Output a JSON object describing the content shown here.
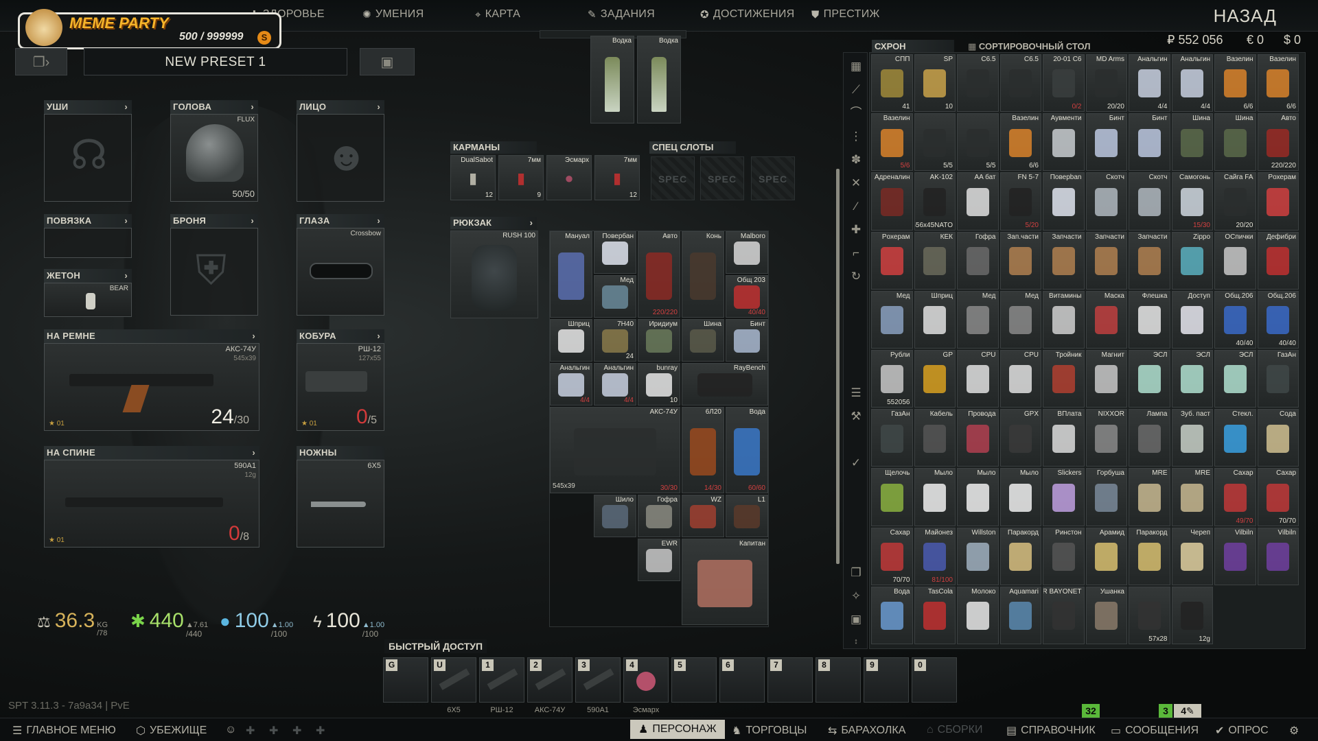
{
  "app": {
    "back_label": "НАЗАД",
    "version": "SPT 3.11.3 - 7a9a34 | PvE"
  },
  "logo": {
    "name": "MEME PARTY",
    "coins": "500 / 999999",
    "coin_icon": "S"
  },
  "nav": [
    {
      "label": "ЗДОРОВЬЕ",
      "icon": "health-icon"
    },
    {
      "label": "УМЕНИЯ",
      "icon": "skills-icon"
    },
    {
      "label": "КАРТА",
      "icon": "map-pin-icon"
    },
    {
      "label": "ЗАДАНИЯ",
      "icon": "tasks-icon"
    },
    {
      "label": "ДОСТИЖЕНИЯ",
      "icon": "achievements-icon"
    },
    {
      "label": "ПРЕСТИЖ",
      "icon": "prestige-icon"
    }
  ],
  "preset": {
    "name": "NEW PRESET 1"
  },
  "gear": {
    "ears": "УШИ",
    "head": {
      "label": "ГОЛОВА",
      "item": "FLUX",
      "durability": "50/50"
    },
    "face": "ЛИЦО",
    "armband": "ПОВЯЗКА",
    "armor": "БРОНЯ",
    "eyes": {
      "label": "ГЛАЗА",
      "item": "Crossbow"
    },
    "dogtag": {
      "label": "ЖЕТОН",
      "item": "BEAR"
    },
    "belt": {
      "label": "НА РЕМНЕ",
      "item": "АКС-74У",
      "caliber": "545x39",
      "ammo": "24",
      "max": "/30",
      "level": "01"
    },
    "holster": {
      "label": "КОБУРА",
      "item": "РШ-12",
      "caliber": "127x55",
      "ammo": "0",
      "max": "/5",
      "level": "01"
    },
    "back": {
      "label": "НА СПИНЕ",
      "item": "590A1",
      "caliber": "12g",
      "ammo": "0",
      "max": "/8",
      "level": "01"
    },
    "knife": {
      "label": "НОЖНЫ",
      "item": "6Х5"
    }
  },
  "stats": {
    "weight": "36.3",
    "weight_unit": "KG",
    "weight_max": "/78",
    "energy": "440",
    "energy_rate": "▲7.61",
    "energy_max": "/440",
    "hydration": "100",
    "hydration_rate": "▲1.00",
    "hydration_max": "/100",
    "stamina": "100",
    "stamina_rate": "▲1.00",
    "stamina_max": "/100"
  },
  "top_items": [
    {
      "name": "Водка"
    },
    {
      "name": "Водка"
    }
  ],
  "pockets": {
    "label": "КАРМАНЫ",
    "items": [
      {
        "name": "DualSabot",
        "q": "12"
      },
      {
        "name": "7мм",
        "q": "9"
      },
      {
        "name": "Эсмарх",
        "q": ""
      },
      {
        "name": "7мм",
        "q": "12"
      }
    ]
  },
  "special": {
    "label": "СПЕЦ СЛОТЫ",
    "slot_label": "SPEC"
  },
  "backpack": {
    "label": "РЮКЗАК",
    "item": "RUSH 100",
    "items": [
      {
        "name": "Мануал",
        "q": ""
      },
      {
        "name": "Повербан",
        "q": ""
      },
      {
        "name": "Авто",
        "q": "220/220"
      },
      {
        "name": "Конь",
        "q": ""
      },
      {
        "name": "Malboro",
        "q": ""
      },
      {
        "name": "Мед",
        "q": ""
      },
      {
        "name": "Общ 203",
        "q": "40/40"
      },
      {
        "name": "Шприц",
        "q": ""
      },
      {
        "name": "7Н40",
        "q": "24"
      },
      {
        "name": "Иридиум",
        "q": ""
      },
      {
        "name": "Шина",
        "q": ""
      },
      {
        "name": "Бинт",
        "q": ""
      },
      {
        "name": "Анальгин",
        "q": "4/4"
      },
      {
        "name": "Анальгин",
        "q": "4/4"
      },
      {
        "name": "bunray",
        "q": "10"
      },
      {
        "name": "RayBench",
        "q": ""
      },
      {
        "name": "АКС-74У",
        "q": "30/30"
      },
      {
        "name": "6Л20",
        "q": "14/30"
      },
      {
        "name": "Вода",
        "q": "60/60"
      },
      {
        "name": "Шило",
        "q": ""
      },
      {
        "name": "Гофра",
        "q": ""
      },
      {
        "name": "WZ",
        "q": ""
      },
      {
        "name": "L1",
        "q": ""
      },
      {
        "name": "EWR",
        "q": ""
      },
      {
        "name": "Капитан",
        "q": ""
      }
    ],
    "ak_caliber": "545x39"
  },
  "stash": {
    "tab_stash": "СХРОН",
    "tab_sort": "СОРТИРОВОЧНЫЙ СТОЛ",
    "money": {
      "rub": "₽ 552 056",
      "eur": "€ 0",
      "usd": "$ 0"
    },
    "items": [
      {
        "name": "СПП",
        "q": "41"
      },
      {
        "name": "SP",
        "q": "10"
      },
      {
        "name": "С6.5",
        "q": ""
      },
      {
        "name": "С6.5",
        "q": ""
      },
      {
        "name": "20-01 С6",
        "q": "0/2"
      },
      {
        "name": "MD Arms",
        "q": "20/20"
      },
      {
        "name": "Анальгин",
        "q": "4/4"
      },
      {
        "name": "Анальгин",
        "q": "4/4"
      },
      {
        "name": "Вазелин",
        "q": "6/6"
      },
      {
        "name": "Вазелин",
        "q": "6/6"
      },
      {
        "name": "Вазелин",
        "q": "5/6"
      },
      {
        "name": "",
        "q": "5/5"
      },
      {
        "name": "",
        "q": "5/5"
      },
      {
        "name": "Вазелин",
        "q": "6/6"
      },
      {
        "name": "Аувменти",
        "q": ""
      },
      {
        "name": "Бинт",
        "q": ""
      },
      {
        "name": "Бинт",
        "q": ""
      },
      {
        "name": "Шина",
        "q": ""
      },
      {
        "name": "Шина",
        "q": ""
      },
      {
        "name": "Авто",
        "q": "220/220"
      },
      {
        "name": "Адреналин",
        "q": ""
      },
      {
        "name": "AK-102",
        "q": "556x45NATO"
      },
      {
        "name": "AA бат",
        "q": ""
      },
      {
        "name": "FN 5-7",
        "q": "5/20"
      },
      {
        "name": "Поверban",
        "q": ""
      },
      {
        "name": "Скотч",
        "q": ""
      },
      {
        "name": "Скотч",
        "q": ""
      },
      {
        "name": "Самогонь",
        "q": "15/30"
      },
      {
        "name": "Сайга FA",
        "q": "20/20"
      },
      {
        "name": "Pохерам",
        "q": ""
      },
      {
        "name": "Pохерам",
        "q": ""
      },
      {
        "name": "КЕК",
        "q": ""
      },
      {
        "name": "Гофра",
        "q": ""
      },
      {
        "name": "Зап.части",
        "q": ""
      },
      {
        "name": "Запчасти",
        "q": ""
      },
      {
        "name": "Запчасти",
        "q": ""
      },
      {
        "name": "Запчасти",
        "q": ""
      },
      {
        "name": "Zippo",
        "q": ""
      },
      {
        "name": "ОСпички",
        "q": ""
      },
      {
        "name": "Дефибри",
        "q": ""
      },
      {
        "name": "Мед",
        "q": ""
      },
      {
        "name": "Шприц",
        "q": ""
      },
      {
        "name": "Мед",
        "q": ""
      },
      {
        "name": "Мед",
        "q": ""
      },
      {
        "name": "Витамины",
        "q": ""
      },
      {
        "name": "Маска",
        "q": ""
      },
      {
        "name": "Флешка",
        "q": ""
      },
      {
        "name": "Доступ",
        "q": ""
      },
      {
        "name": "Общ.206",
        "q": "40/40"
      },
      {
        "name": "Общ.206",
        "q": "40/40"
      },
      {
        "name": "Рубли",
        "q": "552056"
      },
      {
        "name": "GP",
        "q": ""
      },
      {
        "name": "CPU",
        "q": ""
      },
      {
        "name": "CPU",
        "q": ""
      },
      {
        "name": "Тройник",
        "q": ""
      },
      {
        "name": "Магнит",
        "q": ""
      },
      {
        "name": "ЭСЛ",
        "q": ""
      },
      {
        "name": "ЭСЛ",
        "q": ""
      },
      {
        "name": "ЭСЛ",
        "q": ""
      },
      {
        "name": "ГазАн",
        "q": ""
      },
      {
        "name": "ГазАн",
        "q": ""
      },
      {
        "name": "Кабель",
        "q": ""
      },
      {
        "name": "Провода",
        "q": ""
      },
      {
        "name": "GPX",
        "q": ""
      },
      {
        "name": "ВПлата",
        "q": ""
      },
      {
        "name": "NIXXOR",
        "q": ""
      },
      {
        "name": "Лампа",
        "q": ""
      },
      {
        "name": "Зуб. паст",
        "q": ""
      },
      {
        "name": "Стекл.",
        "q": ""
      },
      {
        "name": "Сода",
        "q": ""
      },
      {
        "name": "Щелочь",
        "q": ""
      },
      {
        "name": "Мыло",
        "q": ""
      },
      {
        "name": "Мыло",
        "q": ""
      },
      {
        "name": "Мыло",
        "q": ""
      },
      {
        "name": "Slickers",
        "q": ""
      },
      {
        "name": "Горбуша",
        "q": ""
      },
      {
        "name": "MRE",
        "q": ""
      },
      {
        "name": "MRE",
        "q": ""
      },
      {
        "name": "Сахар",
        "q": "49/70"
      },
      {
        "name": "Сахар",
        "q": "70/70"
      },
      {
        "name": "Сахар",
        "q": "70/70"
      },
      {
        "name": "Майонез",
        "q": "81/100"
      },
      {
        "name": "Willston",
        "q": ""
      },
      {
        "name": "Паракорд",
        "q": ""
      },
      {
        "name": "Ринстон",
        "q": ""
      },
      {
        "name": "Арамид",
        "q": ""
      },
      {
        "name": "Паракорд",
        "q": ""
      },
      {
        "name": "Череп",
        "q": ""
      },
      {
        "name": "Vilbiln",
        "q": ""
      },
      {
        "name": "Vilbiln",
        "q": ""
      },
      {
        "name": "Вода",
        "q": ""
      },
      {
        "name": "TasCola",
        "q": ""
      },
      {
        "name": "Молоко",
        "q": ""
      },
      {
        "name": "Aquamari",
        "q": ""
      },
      {
        "name": "ER BAYONET",
        "q": ""
      },
      {
        "name": "Ушанка",
        "q": ""
      },
      {
        "name": "",
        "q": "57x28"
      },
      {
        "name": "",
        "q": "12g"
      }
    ]
  },
  "quick": {
    "label": "БЫСТРЫЙ ДОСТУП",
    "slots": [
      {
        "key": "G",
        "label": ""
      },
      {
        "key": "U",
        "label": "6Х5"
      },
      {
        "key": "1",
        "label": "РШ-12"
      },
      {
        "key": "2",
        "label": "АКС-74У"
      },
      {
        "key": "3",
        "label": "590A1"
      },
      {
        "key": "4",
        "label": "Эсмарх"
      },
      {
        "key": "5",
        "label": ""
      },
      {
        "key": "6",
        "label": ""
      },
      {
        "key": "7",
        "label": ""
      },
      {
        "key": "8",
        "label": ""
      },
      {
        "key": "9",
        "label": ""
      },
      {
        "key": "0",
        "label": ""
      }
    ]
  },
  "bottom": {
    "main_menu": "ГЛАВНОЕ МЕНЮ",
    "hideout": "УБЕЖИЩЕ",
    "character": "ПЕРСОНАЖ",
    "traders": "ТОРГОВЦЫ",
    "flea": "БАРАХОЛКА",
    "builds": "СБОРКИ",
    "handbook": "СПРАВОЧНИК",
    "messages": "СООБЩЕНИЯ",
    "survey": "ОПРОС",
    "badge1": "32",
    "badge2": "3",
    "badge3": "4"
  }
}
